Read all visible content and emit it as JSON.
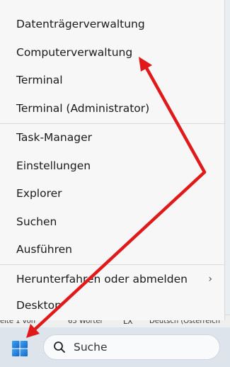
{
  "context_menu": {
    "items": [
      {
        "label": "Datenträgerverwaltung"
      },
      {
        "label": "Computerverwaltung"
      },
      {
        "label": "Terminal"
      },
      {
        "label": "Terminal (Administrator)"
      },
      {
        "label": "Task-Manager"
      },
      {
        "label": "Einstellungen"
      },
      {
        "label": "Explorer"
      },
      {
        "label": "Suchen"
      },
      {
        "label": "Ausführen"
      },
      {
        "label": "Herunterfahren oder abmelden",
        "submenu": "›"
      },
      {
        "label": "Desktop"
      }
    ]
  },
  "statusbar": {
    "page": "eite 1 von",
    "words": "65 Wörter",
    "proofing_icon": "LX",
    "language": "Deutsch (Österreich"
  },
  "taskbar": {
    "start_icon": "windows-logo",
    "search_placeholder": "Suche",
    "accent_color": "#1e7fd9"
  },
  "annotation": {
    "arrow_color": "#e01a1a"
  }
}
